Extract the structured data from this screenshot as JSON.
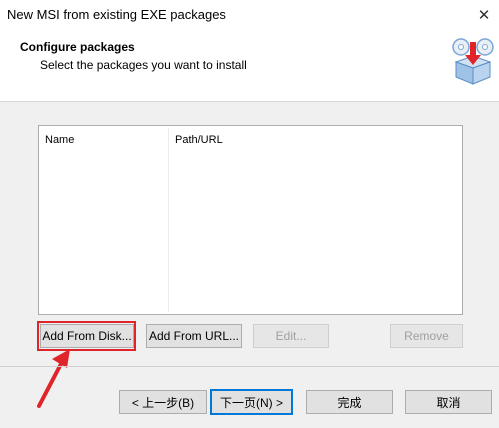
{
  "window": {
    "title": "New MSI from existing EXE packages",
    "close_glyph": "✕"
  },
  "header": {
    "title": "Configure packages",
    "subtitle": "Select the packages you want to install",
    "icon": "package-cd-icon"
  },
  "list": {
    "columns": [
      "Name",
      "Path/URL"
    ],
    "rows": []
  },
  "actions": {
    "add_from_disk": "Add From Disk...",
    "add_from_url": "Add From URL...",
    "edit": "Edit...",
    "remove": "Remove"
  },
  "footer": {
    "back": "< 上一步(B)",
    "next": "下一页(N) >",
    "finish": "完成",
    "cancel": "取消"
  },
  "annotation": {
    "highlight_color": "#e0252a",
    "arrow_color": "#e0252a"
  },
  "colors": {
    "accent": "#0078d7",
    "icon_arrow": "#e0252a",
    "icon_box": "#9fc3e7"
  }
}
